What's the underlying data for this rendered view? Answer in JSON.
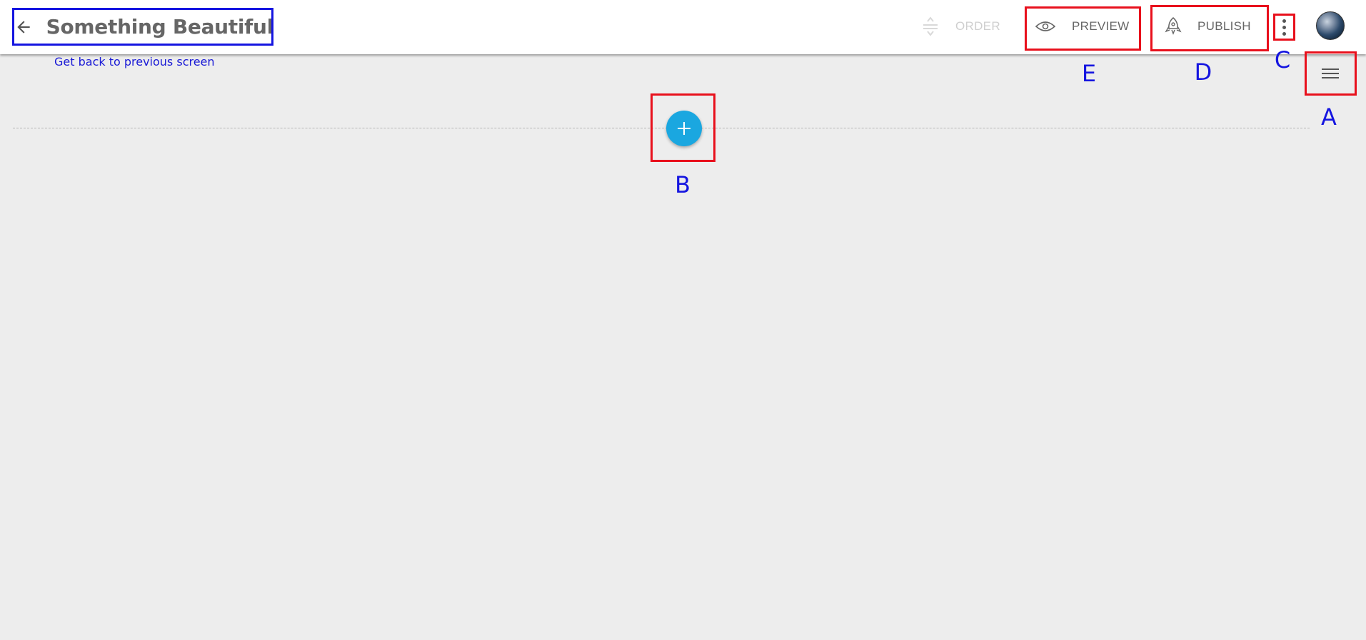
{
  "header": {
    "title": "Something Beautiful",
    "order_label": "ORDER",
    "preview_label": "PREVIEW",
    "publish_label": "PUBLISH"
  },
  "hint": "Get back to previous screen",
  "annotations": {
    "a": "A",
    "b": "B",
    "c": "C",
    "d": "D",
    "e": "E"
  },
  "colors": {
    "annotation_box": "#e8101c",
    "annotation_label": "#1515e0",
    "add_button": "#1aa7e0",
    "background": "#ededed"
  },
  "icons": {
    "back": "arrow-left-icon",
    "order": "order-icon",
    "preview": "eye-icon",
    "publish": "rocket-icon",
    "more": "more-vertical-icon",
    "menu": "hamburger-icon",
    "add": "plus-icon"
  }
}
